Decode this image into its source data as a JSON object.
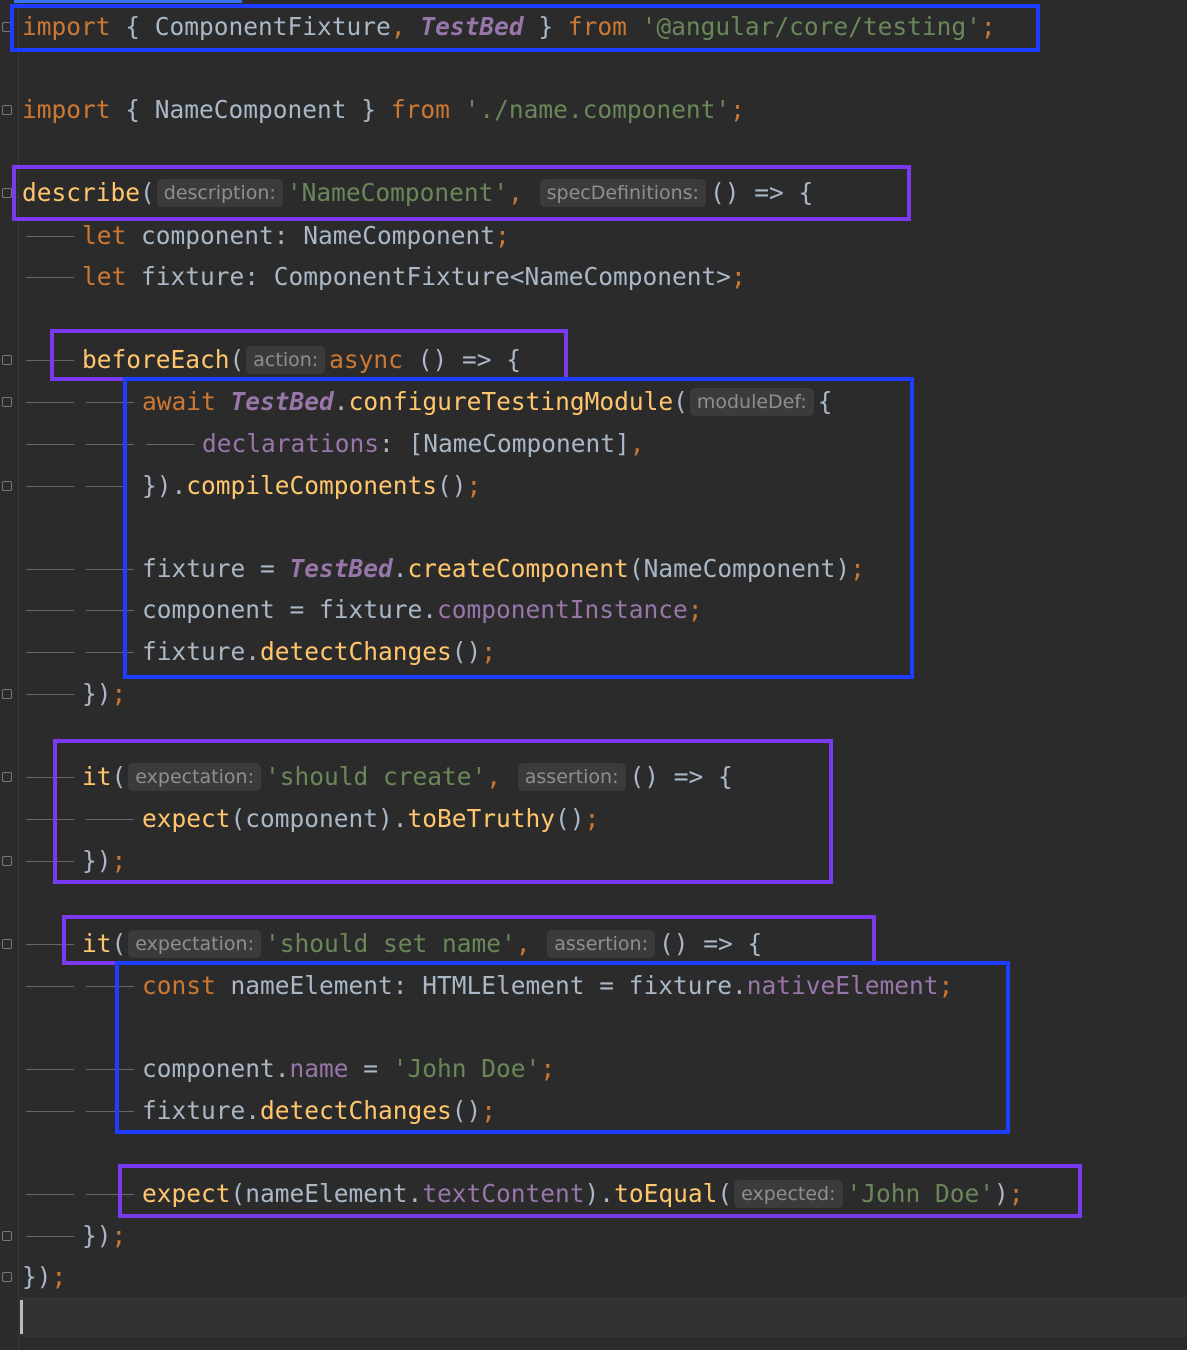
{
  "editor": {
    "language": "TypeScript",
    "colors": {
      "background": "#2b2b2b",
      "keyword": "#cc7832",
      "function": "#ffc66d",
      "string": "#6a8759",
      "property": "#9876aa",
      "plain": "#a9b7c6",
      "highlight_blue": "#1f3dff",
      "highlight_purple": "#7a3bf0"
    },
    "lines": {
      "l1": {
        "kw_import": "import",
        "brace_open": " { ",
        "cls_fixture": "ComponentFixture",
        "comma": ", ",
        "cls_testbed": "TestBed",
        "brace_close": " } ",
        "kw_from": "from",
        "sp": " ",
        "str_path": "'@angular/core/testing'",
        "semi": ";"
      },
      "l2": {
        "kw_import": "import",
        "brace_open": " { ",
        "cls_name": "NameComponent",
        "brace_close": " } ",
        "kw_from": "from",
        "sp": " ",
        "str_path": "'./name.component'",
        "semi": ";"
      },
      "l3": {
        "fn_describe": "describe",
        "paren": "(",
        "hint_description": "description:",
        "str_desc": "'NameComponent'",
        "comma": ", ",
        "hint_spec": "specDefinitions:",
        "arrow": "() => {"
      },
      "l4": {
        "kw_let": "let",
        "rest": " component: NameComponent",
        "semi": ";"
      },
      "l5": {
        "kw_let": "let",
        "rest": " fixture: ComponentFixture<NameComponent>",
        "semi": ";"
      },
      "l6": {
        "fn_beforeEach": "beforeEach",
        "paren": "(",
        "hint_action": "action:",
        "kw_async": "async",
        "arrow": " () => {"
      },
      "l7": {
        "kw_await": "await",
        "sp": " ",
        "cls_testbed": "TestBed",
        "dot": ".",
        "fn_configure": "configureTestingModule",
        "paren": "(",
        "hint_moduleDef": "moduleDef:",
        "brace": "{"
      },
      "l8": {
        "prop_declarations": "declarations",
        "rest": ": [NameComponent]",
        "comma": ","
      },
      "l9": {
        "close": "}).",
        "fn_compile": "compileComponents",
        "parens": "()",
        "semi": ";"
      },
      "l10": {
        "lhs": "fixture = ",
        "cls_testbed": "TestBed",
        "dot": ".",
        "fn_create": "createComponent",
        "args": "(NameComponent)",
        "semi": ";"
      },
      "l11": {
        "lhs": "component = fixture.",
        "prop_instance": "componentInstance",
        "semi": ";"
      },
      "l12": {
        "obj": "fixture.",
        "fn_detect": "detectChanges",
        "parens": "()",
        "semi": ";"
      },
      "l13": {
        "close": "})",
        "semi": ";"
      },
      "l14": {
        "fn_it": "it",
        "paren": "(",
        "hint_expectation": "expectation:",
        "str_create": "'should create'",
        "comma": ", ",
        "hint_assertion": "assertion:",
        "arrow": "() => {"
      },
      "l15": {
        "fn_expect": "expect",
        "args": "(component).",
        "fn_truthy": "toBeTruthy",
        "parens": "()",
        "semi": ";"
      },
      "l16": {
        "close": "})",
        "semi": ";"
      },
      "l17": {
        "fn_it": "it",
        "paren": "(",
        "hint_expectation": "expectation:",
        "str_setname": "'should set name'",
        "comma": ", ",
        "hint_assertion": "assertion:",
        "arrow": "() => {"
      },
      "l18": {
        "kw_const": "const",
        "decl": " nameElement: HTMLElement = fixture.",
        "prop_native": "nativeElement",
        "semi": ";"
      },
      "l19": {
        "obj": "component.",
        "prop_name": "name",
        "eq": " = ",
        "str_john": "'John Doe'",
        "semi": ";"
      },
      "l20": {
        "obj": "fixture.",
        "fn_detect": "detectChanges",
        "parens": "()",
        "semi": ";"
      },
      "l21": {
        "fn_expect": "expect",
        "args1": "(nameElement.",
        "prop_text": "textContent",
        "args2": ").",
        "fn_toEqual": "toEqual",
        "paren": "(",
        "hint_expected": "expected:",
        "str_john": "'John Doe'",
        "close": ")",
        "semi": ";"
      },
      "l22": {
        "close": "})",
        "semi": ";"
      },
      "l23": {
        "close": "})",
        "semi": ";"
      }
    }
  }
}
